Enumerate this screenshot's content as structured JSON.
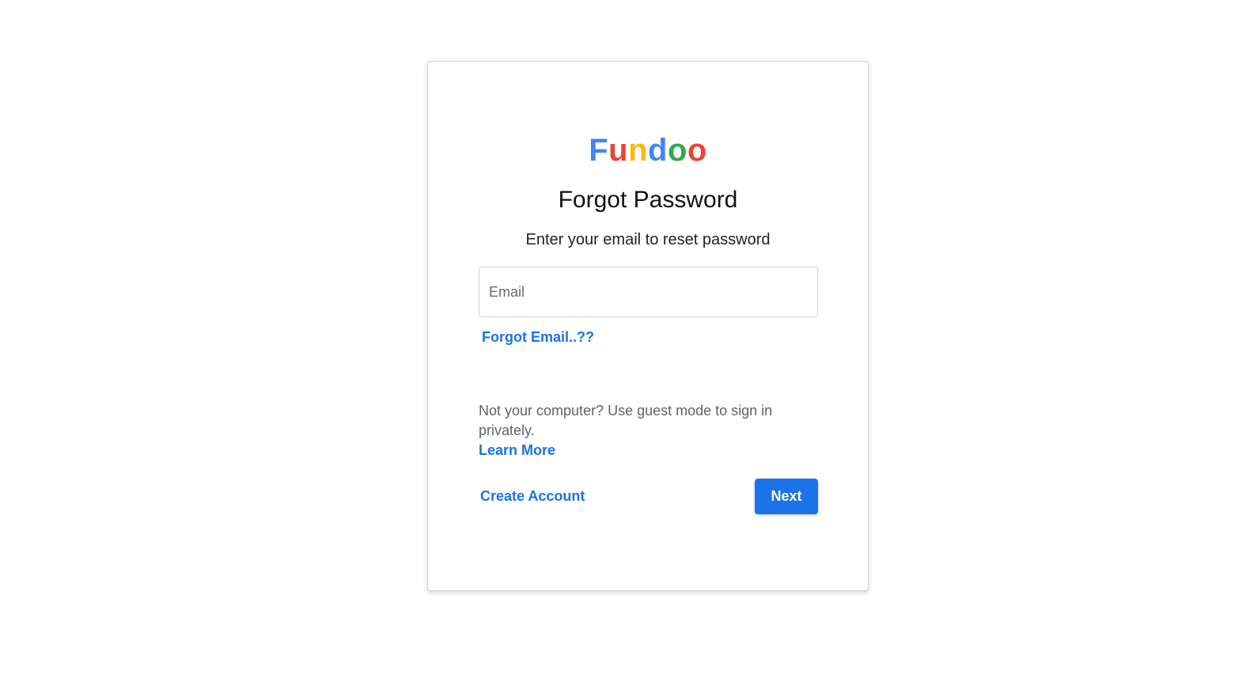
{
  "logo": {
    "letters": [
      {
        "char": "F",
        "color": "#4285f4"
      },
      {
        "char": "u",
        "color": "#ea4335"
      },
      {
        "char": "n",
        "color": "#fbbc05"
      },
      {
        "char": "d",
        "color": "#4285f4"
      },
      {
        "char": "o",
        "color": "#34a853"
      },
      {
        "char": "o",
        "color": "#ea4335"
      }
    ]
  },
  "form": {
    "title": "Forgot Password",
    "subtitle": "Enter your email to reset password",
    "email_placeholder": "Email",
    "forgot_email_link": "Forgot Email..??"
  },
  "guest": {
    "text": "Not your computer? Use guest mode to sign in privately.",
    "learn_more": "Learn More"
  },
  "actions": {
    "create_account": "Create Account",
    "next": "Next"
  },
  "colors": {
    "accent": "#1a73e8"
  }
}
